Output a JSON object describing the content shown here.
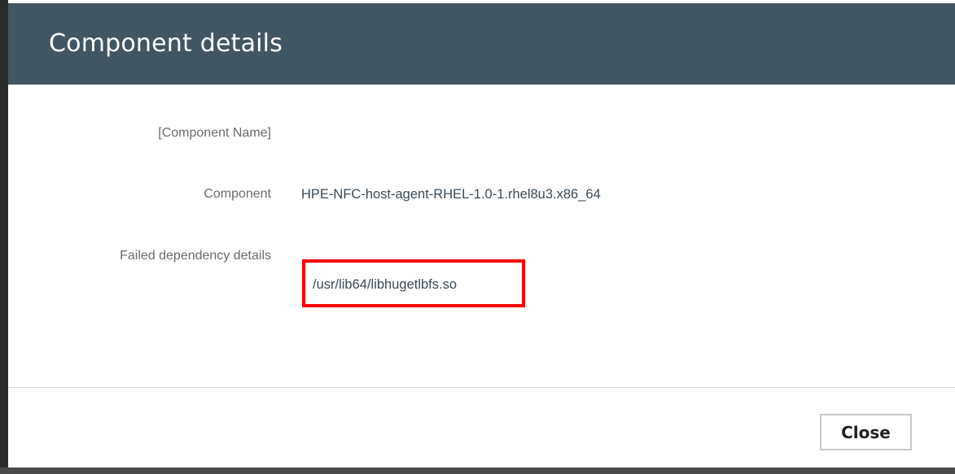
{
  "dialog": {
    "title": "Component details",
    "fields": [
      {
        "label": "[Component Name]",
        "value": ""
      },
      {
        "label": "Component",
        "value": "HPE-NFC-host-agent-RHEL-1.0-1.rhel8u3.x86_64"
      },
      {
        "label": "Failed dependency details",
        "value": "/usr/lib64/libhugetlbfs.so"
      }
    ],
    "close_label": "Close"
  },
  "colors": {
    "header": "#425563",
    "highlight": "#ff0000",
    "label_text": "#6b6b6b",
    "value_text": "#3b4a57"
  }
}
